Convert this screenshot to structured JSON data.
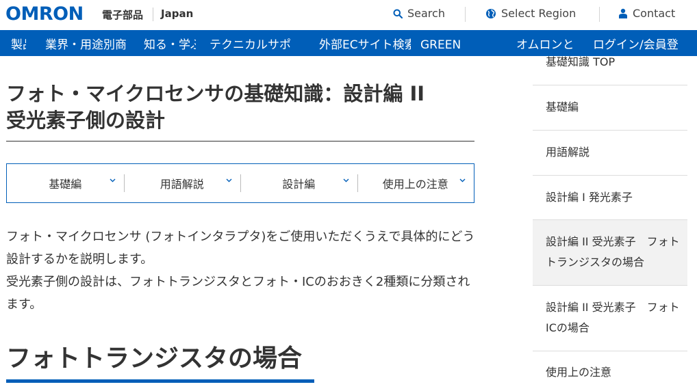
{
  "header": {
    "logo": "OMRON",
    "division": "電子部品",
    "region": "Japan",
    "search_label": "Search",
    "select_region_label": "Select Region",
    "contact_label": "Contact"
  },
  "nav": {
    "items": [
      "製品",
      "業界・用途別商",
      "知る・学ぶ",
      "テクニカルサポ",
      "外部ECサイト検索",
      "GREEN",
      "オムロンと",
      "ログイン/会員登"
    ]
  },
  "page": {
    "title_line1": "フォト・マイクロセンサの基礎知識：設計編 II",
    "title_line2": "受光素子側の設計",
    "tabs": [
      "基礎編",
      "用語解説",
      "設計編",
      "使用上の注意"
    ],
    "intro_p1": "フォト・マイクロセンサ (フォトインタラプタ)をご使用いただくうえで具体的にどう設計するかを説明します。",
    "intro_p2": "受光素子側の設計は、フォトトランジスタとフォト・ICのおおきく2種類に分類されます。",
    "section_heading": "フォトトランジスタの場合"
  },
  "sidebar": {
    "items": [
      {
        "label": "基礎知識 TOP"
      },
      {
        "label": "基礎編"
      },
      {
        "label": "用語解説"
      },
      {
        "label": "設計編 I  発光素子"
      },
      {
        "label": "設計編 II 受光素子　フォトトランジスタの場合",
        "active": true
      },
      {
        "label": "設計編 II 受光素子　フォトICの場合"
      },
      {
        "label": "使用上の注意"
      }
    ]
  },
  "colors": {
    "brand_blue": "#005eb8",
    "text": "#333333",
    "active_bg": "#f2f2f2"
  }
}
